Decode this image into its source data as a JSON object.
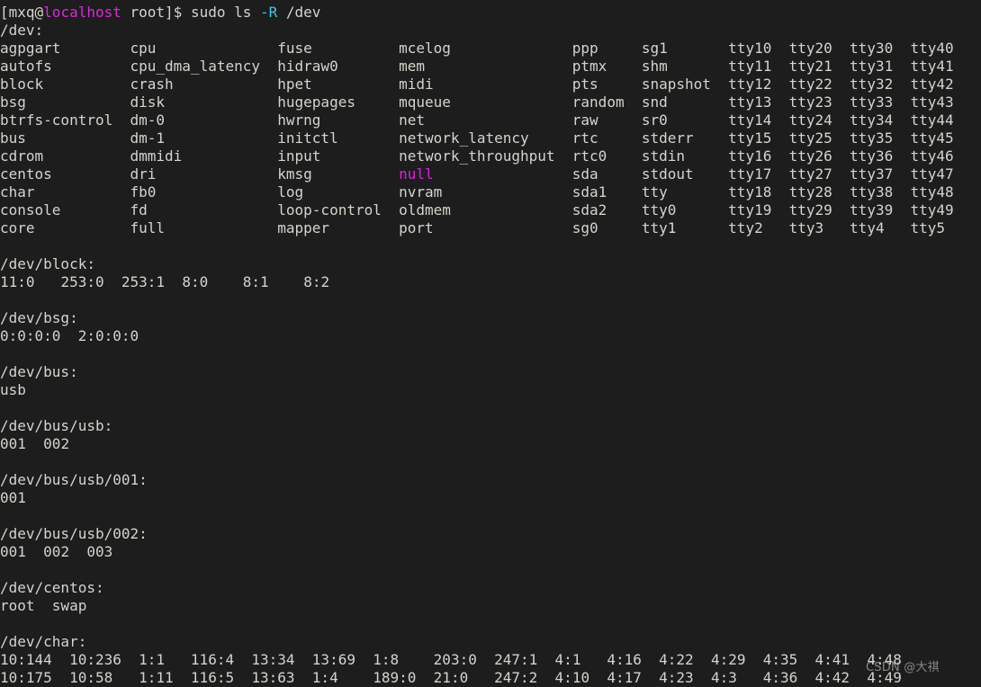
{
  "terminal": {
    "background_color": "#1d1d1d",
    "foreground_color": "#d6d3cc",
    "magenta_color": "#e01ee0",
    "cyan_color": "#3fc4e0",
    "host_color": "#d92ad9",
    "font_size_px": 16,
    "line_height_px": 20,
    "columns": 68,
    "rows": 38
  },
  "prompt": {
    "bracket_open": "[",
    "user": "mxq",
    "at": "@",
    "host": "localhost",
    "space_path": " root",
    "bracket_close": "]",
    "sigil": "$ ",
    "command_head": "sudo ls ",
    "command_flag": "-R",
    "command_tail": " /dev"
  },
  "watermark": {
    "text": "CSDN @大祺"
  },
  "listings": [
    {
      "header": "/dev:",
      "kind": "columns",
      "columns": [
        [
          "agpgart",
          "autofs",
          "block",
          "bsg",
          "btrfs-control",
          "bus",
          "cdrom",
          "centos",
          "char",
          "console",
          "core"
        ],
        [
          "cpu",
          "cpu_dma_latency",
          "crash",
          "disk",
          "dm-0",
          "dm-1",
          "dmmidi",
          "dri",
          "fb0",
          "fd",
          "full"
        ],
        [
          "fuse",
          "hidraw0",
          "hpet",
          "hugepages",
          "hwrng",
          "initctl",
          "input",
          "kmsg",
          "log",
          "loop-control",
          "mapper"
        ],
        [
          "mcelog",
          "mem",
          "midi",
          "mqueue",
          "net",
          "network_latency",
          "network_throughput",
          "null",
          "nvram",
          "oldmem",
          "port"
        ],
        [
          "ppp",
          "ptmx",
          "pts",
          "random",
          "raw",
          "rtc",
          "rtc0",
          "sda",
          "sda1",
          "sda2",
          "sg0"
        ],
        [
          "sg1",
          "shm",
          "snapshot",
          "snd",
          "sr0",
          "stderr",
          "stdin",
          "stdout",
          "tty",
          "tty0",
          "tty1"
        ],
        [
          "tty10",
          "tty11",
          "tty12",
          "tty13",
          "tty14",
          "tty15",
          "tty16",
          "tty17",
          "tty18",
          "tty19",
          "tty2"
        ],
        [
          "tty20",
          "tty21",
          "tty22",
          "tty23",
          "tty24",
          "tty25",
          "tty26",
          "tty27",
          "tty28",
          "tty29",
          "tty3"
        ],
        [
          "tty30",
          "tty31",
          "tty32",
          "tty33",
          "tty34",
          "tty35",
          "tty36",
          "tty37",
          "tty38",
          "tty39",
          "tty4"
        ],
        [
          "tty40",
          "tty41",
          "tty42",
          "tty43",
          "tty44",
          "tty45",
          "tty46",
          "tty47",
          "tty48",
          "tty49",
          "tty5"
        ]
      ],
      "magenta_entries": [
        "null"
      ]
    },
    {
      "header": "/dev/block:",
      "kind": "inline",
      "rows": [
        [
          "11:0",
          "253:0",
          "253:1",
          "8:0",
          "8:1",
          "8:2"
        ]
      ]
    },
    {
      "header": "/dev/bsg:",
      "kind": "inline",
      "rows": [
        [
          "0:0:0:0",
          "2:0:0:0"
        ]
      ]
    },
    {
      "header": "/dev/bus:",
      "kind": "inline",
      "rows": [
        [
          "usb"
        ]
      ]
    },
    {
      "header": "/dev/bus/usb:",
      "kind": "inline",
      "rows": [
        [
          "001",
          "002"
        ]
      ]
    },
    {
      "header": "/dev/bus/usb/001:",
      "kind": "inline",
      "rows": [
        [
          "001"
        ]
      ]
    },
    {
      "header": "/dev/bus/usb/002:",
      "kind": "inline",
      "rows": [
        [
          "001",
          "002",
          "003"
        ]
      ]
    },
    {
      "header": "/dev/centos:",
      "kind": "inline",
      "rows": [
        [
          "root",
          "swap"
        ]
      ]
    },
    {
      "header": "/dev/char:",
      "kind": "columns",
      "columns": [
        [
          "10:144",
          "10:175"
        ],
        [
          "10:236",
          "10:58"
        ],
        [
          "1:1",
          "1:11"
        ],
        [
          "116:4",
          "116:5"
        ],
        [
          "13:34",
          "13:63"
        ],
        [
          "13:69",
          "1:4"
        ],
        [
          "1:8",
          "189:0"
        ],
        [
          "203:0",
          "21:0"
        ],
        [
          "247:1",
          "247:2"
        ],
        [
          "4:1",
          "4:10"
        ],
        [
          "4:16",
          "4:17"
        ],
        [
          "4:22",
          "4:23"
        ],
        [
          "4:29",
          "4:3"
        ],
        [
          "4:35",
          "4:36"
        ],
        [
          "4:41",
          "4:42"
        ],
        [
          "4:48",
          "4:49"
        ]
      ],
      "magenta_entries": []
    }
  ]
}
